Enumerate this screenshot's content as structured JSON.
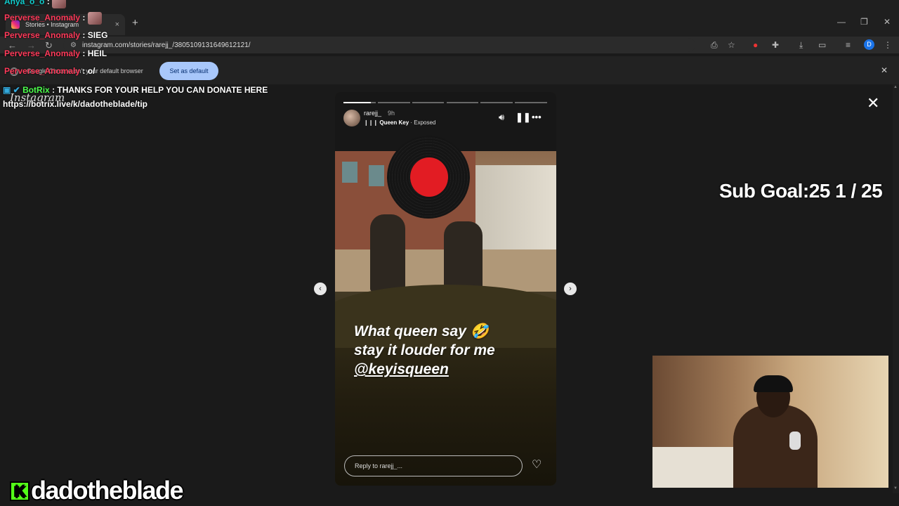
{
  "browser": {
    "tab_title": "Stories • Instagram",
    "tab_close": "×",
    "new_tab": "+",
    "url": "instagram.com/stories/rarejj_/3805109131649612121/",
    "profile_initial": "D",
    "infobar": {
      "text": "Google Chrome isn't your default browser",
      "set_default_label": "Set as default"
    }
  },
  "page": {
    "brand": "Instagram",
    "close": "✕"
  },
  "story": {
    "username": "rarejj_",
    "time": "9h",
    "music_song": "Queen Key",
    "music_rest": " · Exposed",
    "caption": [
      "What queen say 🤣",
      "stay it louder for me"
    ],
    "mention": "@keyisqueen",
    "reply_placeholder": "Reply to rarejj_...",
    "progress_fraction": 0.14
  },
  "stream": {
    "chat": [
      {
        "name": "Anya_o_o",
        "message": " : ",
        "emote": true,
        "color": "teal"
      },
      {
        "name": "Perverse_Anomaly",
        "message": " : ",
        "emote": true,
        "color": "red"
      },
      {
        "name": "Perverse_Anomaly",
        "message": " : SIEG",
        "emote": false,
        "color": "red"
      },
      {
        "name": "Perverse_Anomaly",
        "message": " : HEIL",
        "emote": false,
        "color": "red"
      },
      {
        "name": "Perverse_Anomaly",
        "message": " : o/",
        "emote": false,
        "color": "red"
      },
      {
        "name": "BotRix",
        "message": " : THANKS FOR YOUR HELP YOU CAN DONATE HERE",
        "emote": false,
        "color": "green"
      }
    ],
    "donate_link": "https://botrix.live/k/dadotheblade/tip",
    "sub_goal": "Sub Goal:25  1 / 25",
    "watermark": "dadotheblade",
    "kick_glyph": "K"
  }
}
